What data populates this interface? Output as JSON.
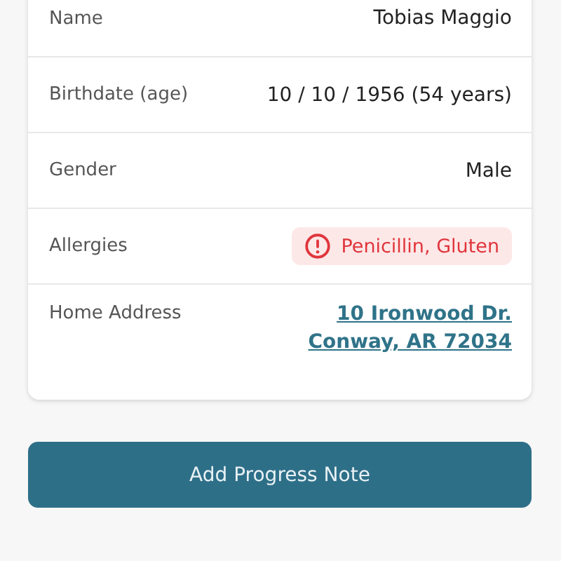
{
  "rows": [
    {
      "kind": "text",
      "label": "Name",
      "value": "Tobias Maggio"
    },
    {
      "kind": "text",
      "label": "Birthdate (age)",
      "value": "10 / 10 / 1956 (54 years)"
    },
    {
      "kind": "text",
      "label": "Gender",
      "value": "Male"
    },
    {
      "kind": "alert",
      "label": "Allergies",
      "value": "Penicillin, Gluten"
    },
    {
      "kind": "link",
      "label": "Home Address",
      "lines": [
        "10 Ironwood Dr.",
        "Conway, AR 72034"
      ]
    }
  ],
  "button": {
    "label": "Add Progress Note"
  }
}
